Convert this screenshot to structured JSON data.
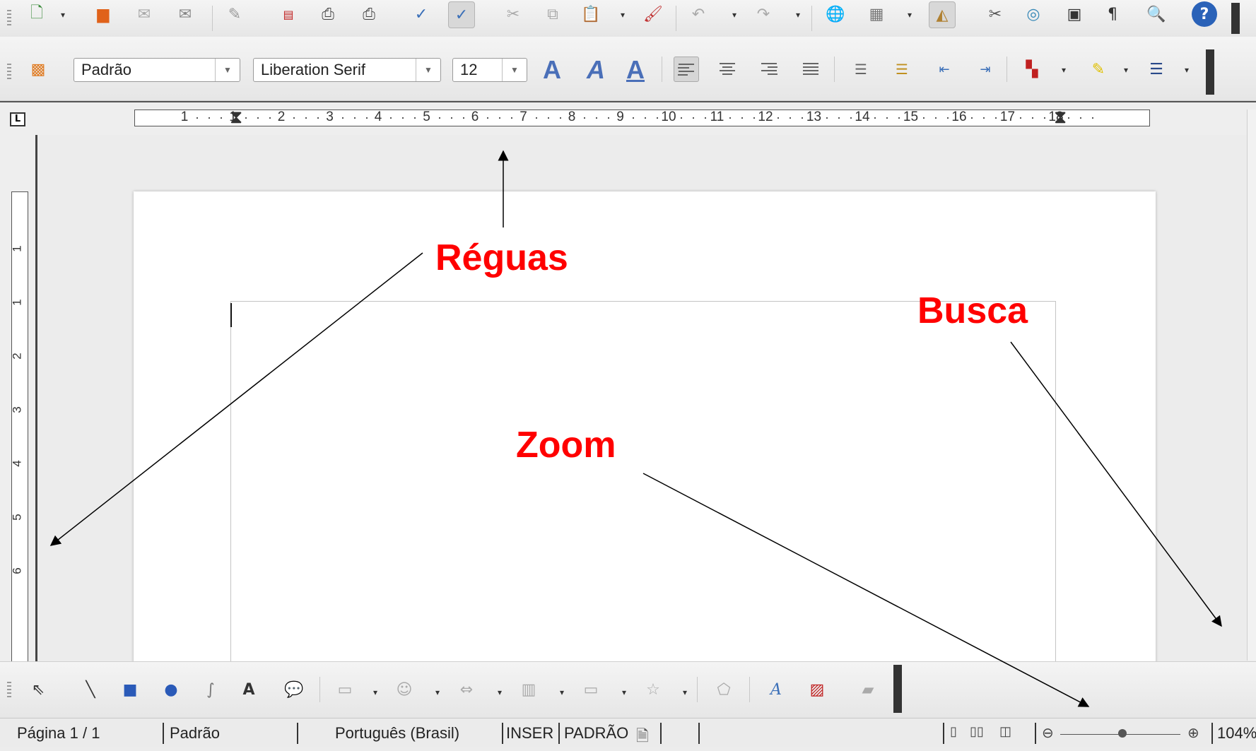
{
  "toolbar_standard": {
    "icons": [
      "new-document-icon",
      "open-folder-icon",
      "email-icon",
      "edit-document-icon",
      "edit-mode-icon",
      "export-pdf-icon",
      "print-icon",
      "print-preview-icon",
      "spellcheck-icon",
      "autospellcheck-icon",
      "cut-icon",
      "copy-icon",
      "paste-icon",
      "clone-format-icon",
      "undo-icon",
      "redo-icon",
      "hyperlink-icon",
      "table-icon",
      "draw-functions-icon",
      "find-replace-icon",
      "navigator-icon",
      "gallery-icon",
      "formatting-marks-icon",
      "zoom-icon",
      "help-icon"
    ]
  },
  "toolbar_formatting": {
    "paragraph_style": "Padrão",
    "font_name": "Liberation Serif",
    "font_size": "12",
    "bold_glyph": "A",
    "italic_glyph": "A",
    "underline_glyph": "A"
  },
  "ruler": {
    "horizontal_numbers": [
      "1",
      "1",
      "2",
      "3",
      "4",
      "5",
      "6",
      "7",
      "8",
      "9",
      "10",
      "11",
      "12",
      "13",
      "14",
      "15",
      "16",
      "17",
      "18"
    ],
    "vertical_numbers": [
      "1",
      "1",
      "2",
      "3",
      "4",
      "5",
      "6"
    ],
    "corner_symbol": "L"
  },
  "status_bar": {
    "page": "Página 1 / 1",
    "page_style": "Padrão",
    "language": "Português (Brasil)",
    "insert_mode": "INSER",
    "selection_mode": "PADRÃO",
    "zoom": "104%",
    "zoom_level": 0.52
  },
  "annotations": {
    "rulers": "Réguas",
    "search": "Busca",
    "zoom": "Zoom",
    "color": "#ff0000"
  }
}
